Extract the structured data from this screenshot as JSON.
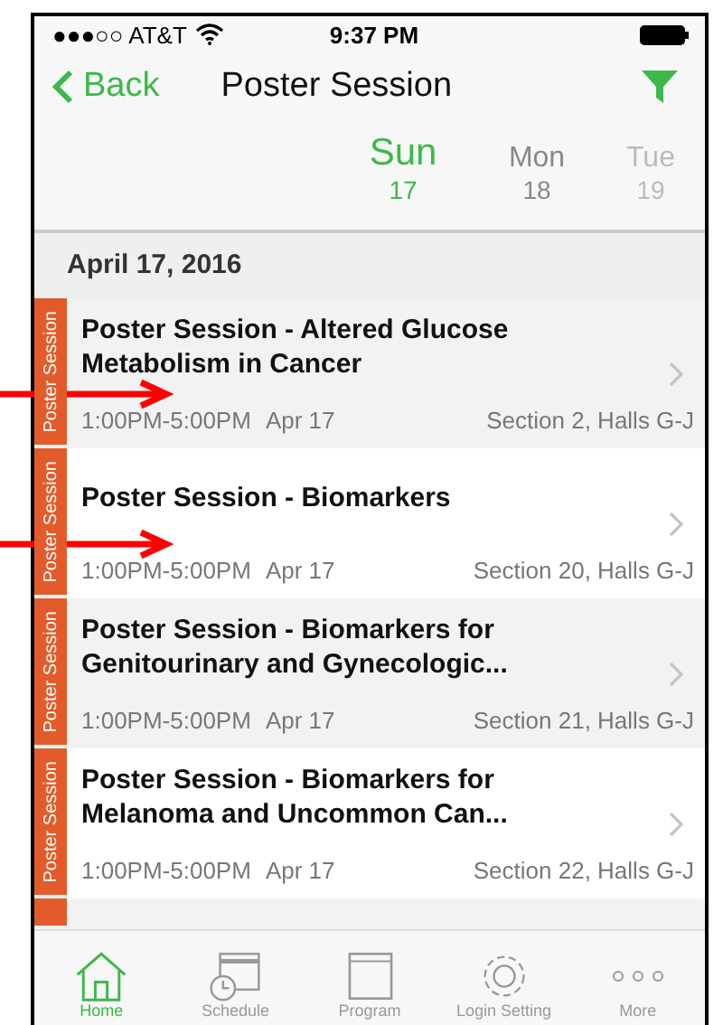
{
  "status_bar": {
    "carrier": "●●●○○ AT&T",
    "time": "9:37 PM"
  },
  "nav": {
    "back": "Back",
    "title": "Poster Session"
  },
  "days": [
    {
      "name": "Sun",
      "date": "17",
      "selected": true
    },
    {
      "name": "Mon",
      "date": "18",
      "selected": false
    },
    {
      "name": "Tue",
      "date": "19",
      "selected": false
    }
  ],
  "section_header": "April 17, 2016",
  "sessions": [
    {
      "track": "Poster Session",
      "title": "Poster Session - Altered Glucose Metabolism in Cancer",
      "time": "1:00PM-5:00PM",
      "date": "Apr 17",
      "location": "Section 2, Halls G-J"
    },
    {
      "track": "Poster Session",
      "title": "Poster Session - Biomarkers",
      "time": "1:00PM-5:00PM",
      "date": "Apr 17",
      "location": "Section 20, Halls G-J"
    },
    {
      "track": "Poster Session",
      "title": "Poster Session - Biomarkers for Genitourinary and Gynecologic...",
      "time": "1:00PM-5:00PM",
      "date": "Apr 17",
      "location": "Section 21, Halls G-J"
    },
    {
      "track": "Poster Session",
      "title": "Poster Session - Biomarkers for Melanoma and Uncommon Can...",
      "time": "1:00PM-5:00PM",
      "date": "Apr 17",
      "location": "Section 22, Halls G-J"
    }
  ],
  "tab_bar": [
    {
      "kind": "home",
      "label": "Home",
      "selected": true
    },
    {
      "kind": "schedule",
      "label": "Schedule",
      "selected": false
    },
    {
      "kind": "program",
      "label": "Program",
      "selected": false
    },
    {
      "kind": "settings",
      "label": "Login Setting",
      "selected": false
    },
    {
      "kind": "more",
      "label": "More",
      "selected": false
    }
  ]
}
